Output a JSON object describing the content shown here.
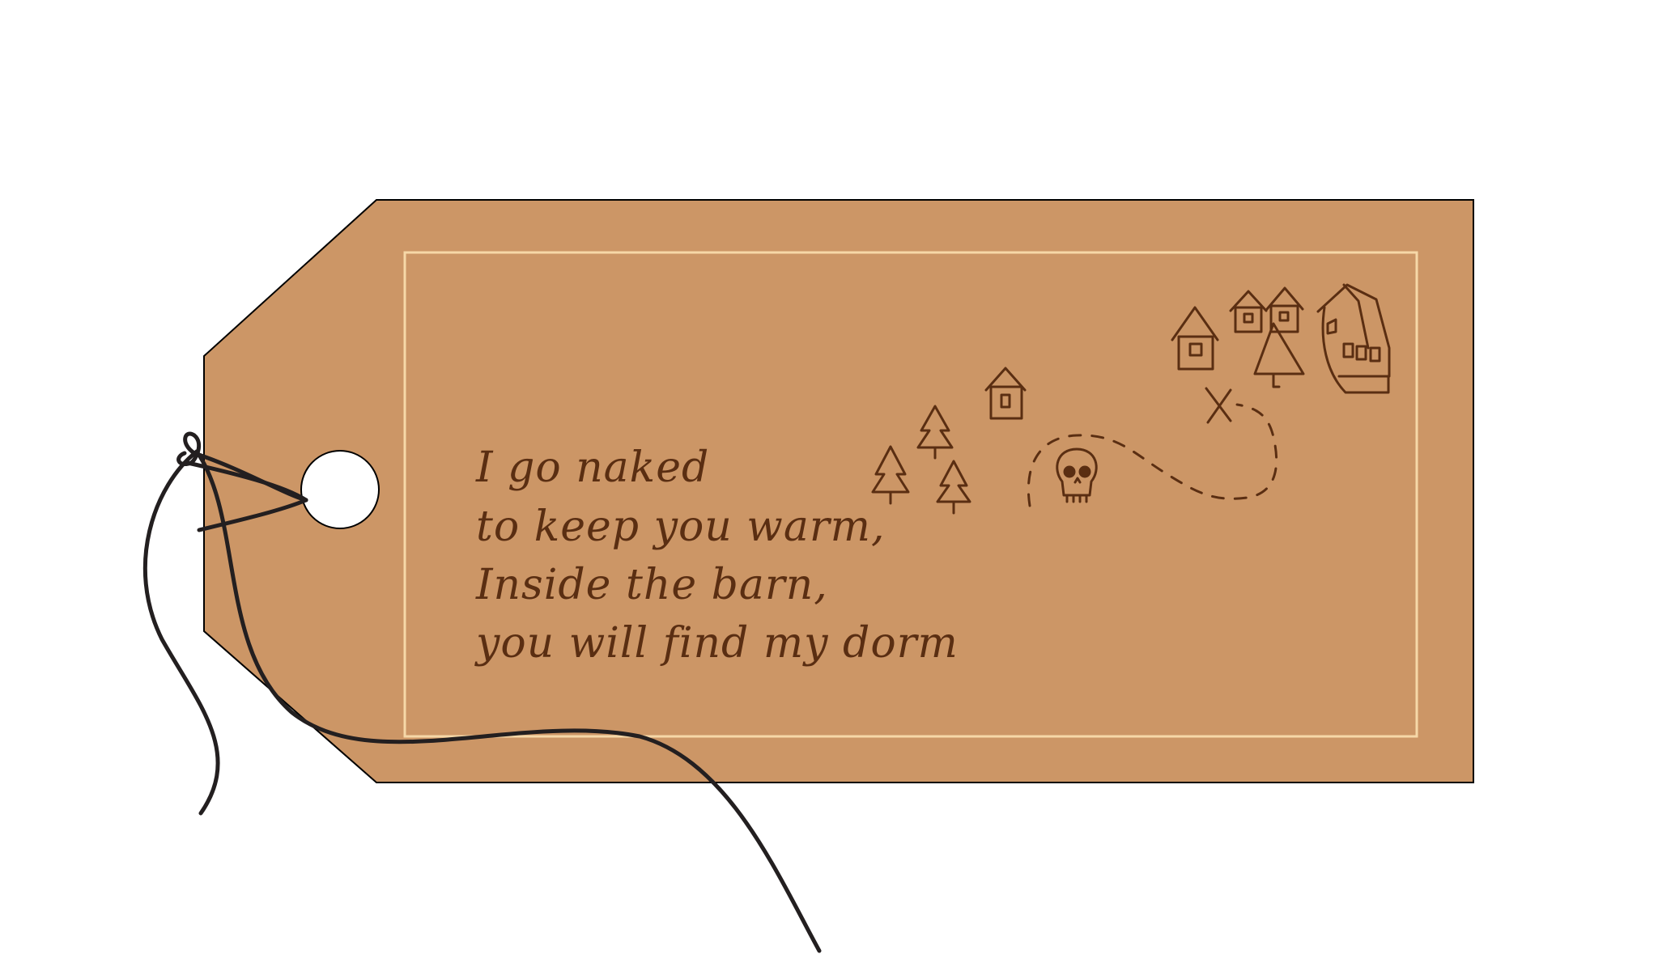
{
  "tag": {
    "color": "#cc9666",
    "border_color": "#000000",
    "inner_border_color": "#f6d8a8",
    "ink_color": "#5a2e12",
    "string_color": "#231f20",
    "hole_color": "#ffffff"
  },
  "poem": {
    "lines": [
      "I go naked",
      "to keep you warm,",
      "Inside the barn,",
      "you will find my dorm"
    ]
  },
  "map_doodle": {
    "icons": [
      "tree-icon",
      "house-icon",
      "skull-icon",
      "x-mark-icon",
      "dashed-path"
    ]
  }
}
